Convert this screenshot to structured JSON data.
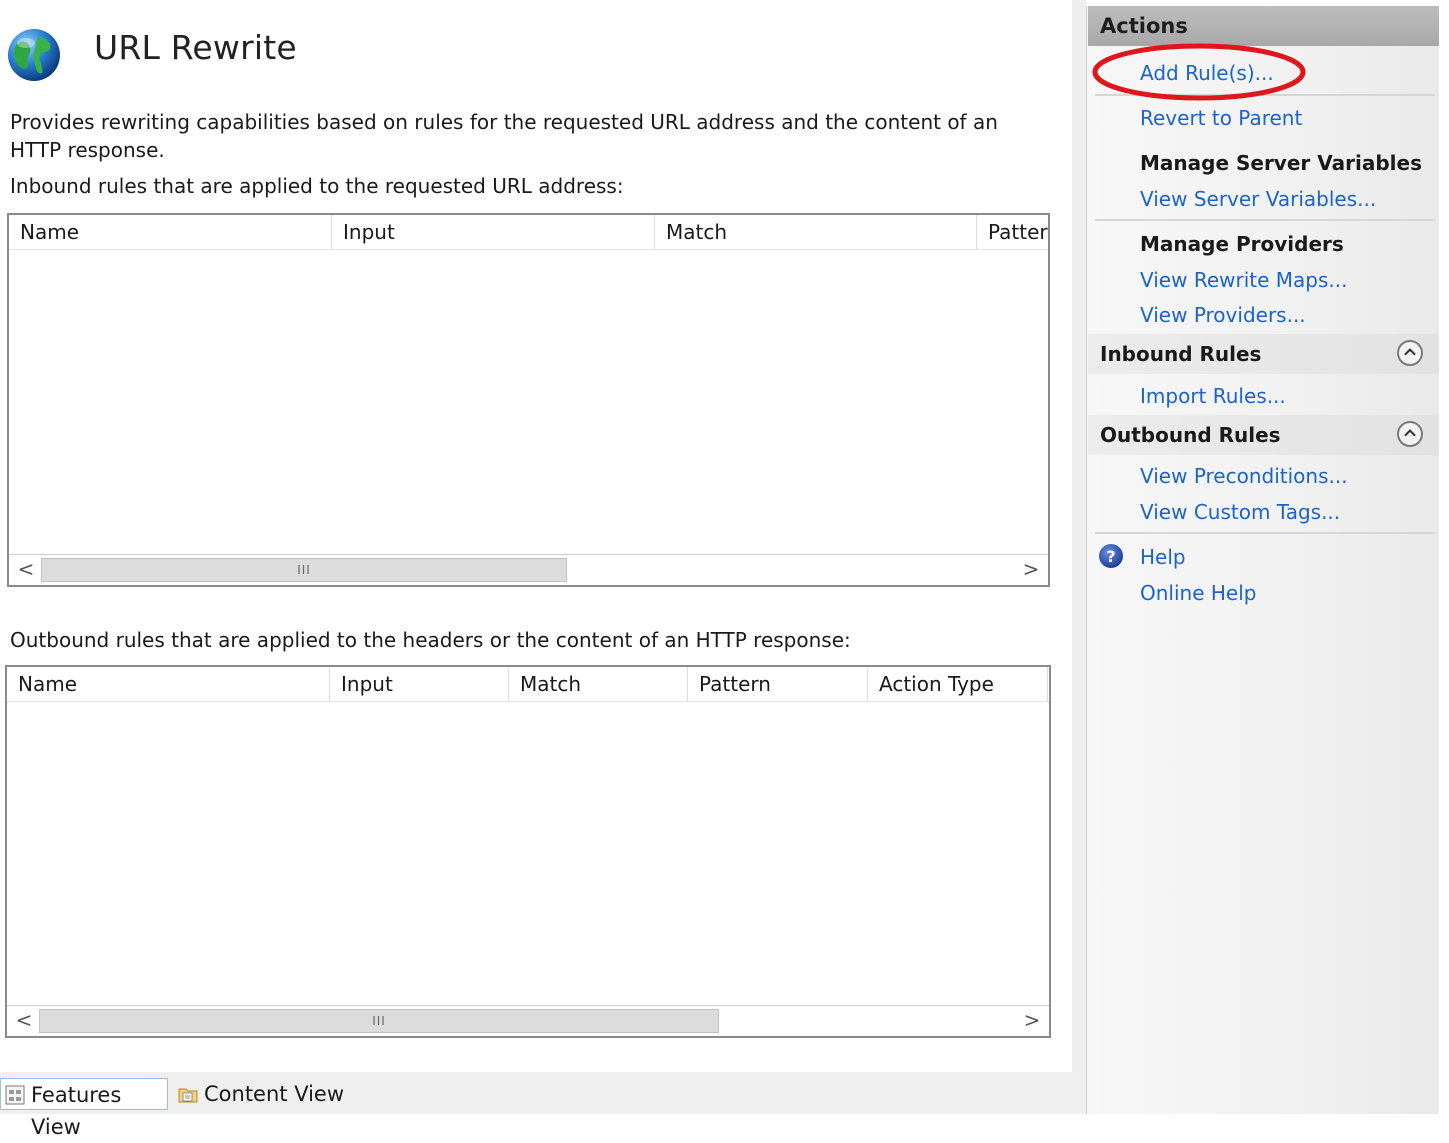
{
  "header": {
    "title": "URL Rewrite",
    "description": "Provides rewriting capabilities based on rules for the requested URL address and the content of an HTTP response."
  },
  "inbound": {
    "caption": "Inbound rules that are applied to the requested URL address:",
    "columns": [
      "Name",
      "Input",
      "Match",
      "Pattern"
    ]
  },
  "outbound": {
    "caption": "Outbound rules that are applied to the headers or the content of an HTTP response:",
    "columns": [
      "Name",
      "Input",
      "Match",
      "Pattern",
      "Action Type"
    ]
  },
  "scrollbar": {
    "left_arrow": "<",
    "right_arrow": ">",
    "grip": "III"
  },
  "view_switch": {
    "features_view": "Features View",
    "content_view": "Content View"
  },
  "actions": {
    "title": "Actions",
    "add_rules": "Add Rule(s)...",
    "revert_to_parent": "Revert to Parent",
    "manage_server_variables": "Manage Server Variables",
    "view_server_variables": "View Server Variables...",
    "manage_providers": "Manage Providers",
    "view_rewrite_maps": "View Rewrite Maps...",
    "view_providers": "View Providers...",
    "inbound_rules": "Inbound Rules",
    "import_rules": "Import Rules...",
    "outbound_rules": "Outbound Rules",
    "view_preconditions": "View Preconditions...",
    "view_custom_tags": "View Custom Tags...",
    "help": "Help",
    "online_help": "Online Help"
  },
  "colors": {
    "link": "#1c63c8",
    "highlight_annotation": "#e0161d",
    "actions_header": "#b1b1b1"
  },
  "icons": {
    "page": "globe-icon",
    "help": "help-icon",
    "collapse": "chevron-up-icon",
    "features_view": "features-view-icon",
    "content_view": "content-view-icon"
  }
}
